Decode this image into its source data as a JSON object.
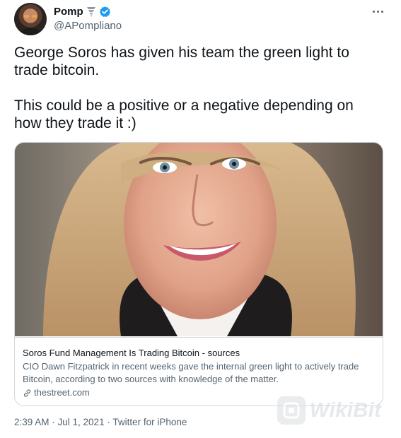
{
  "author": {
    "display_name": "Pomp",
    "handle": "@APompliano",
    "badges": [
      "tornado-emoji-icon",
      "verified-badge-icon"
    ],
    "verified_color": "#1d9bf0"
  },
  "tweet": {
    "paragraphs": [
      "George Soros has given his team the green light to trade bitcoin.",
      "This could be a positive or a negative depending on how they trade it :)"
    ]
  },
  "card": {
    "title": "Soros Fund Management Is Trading Bitcoin - sources",
    "description": "CIO Dawn Fitzpatrick in recent weeks gave the internal green light to actively trade Bitcoin, according to two sources with knowledge of the matter.",
    "domain": "thestreet.com"
  },
  "meta": {
    "timestamp": "2:39 AM · Jul 1, 2021 · Twitter for iPhone"
  },
  "watermark": {
    "text": "WikiBit"
  },
  "colors": {
    "text_primary": "#0f1419",
    "text_secondary": "#536471",
    "border": "#cfd9de"
  }
}
